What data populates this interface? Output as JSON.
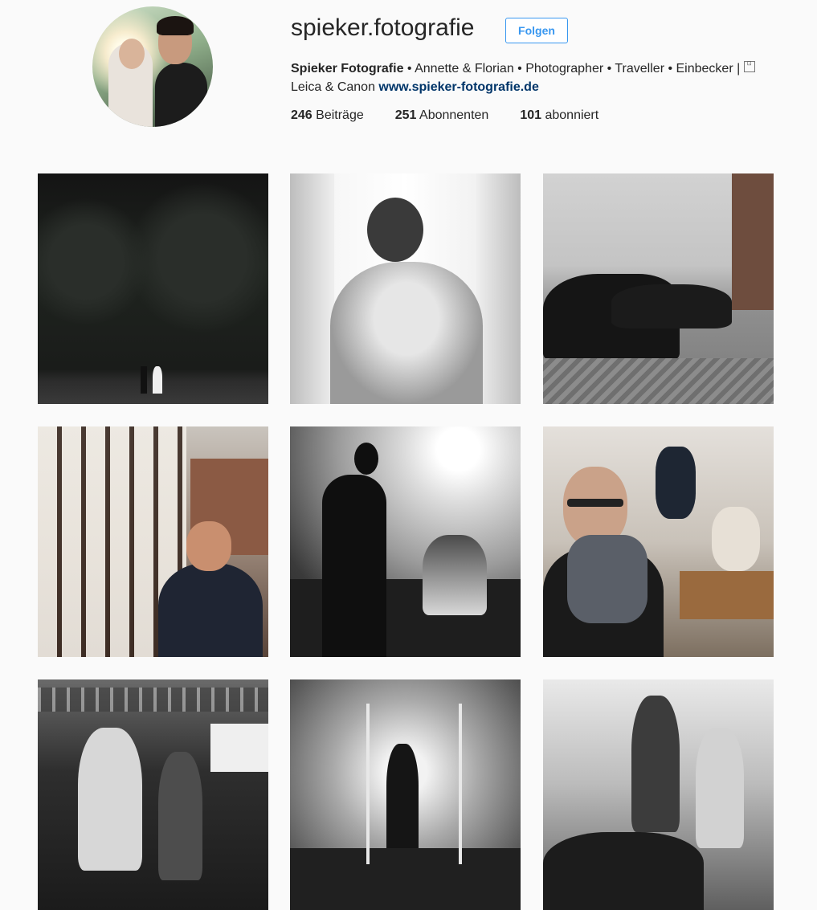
{
  "profile": {
    "username": "spieker.fotografie",
    "follow_label": "Folgen",
    "bio": {
      "name": "Spieker Fotografie",
      "text_line1": " • Annette & Florian • Photographer • Traveller • Einbecker | ",
      "text_line2": "Leica & Canon ",
      "link": "www.spieker-fotografie.de"
    },
    "stats": [
      {
        "count": "246",
        "label": " Beiträge"
      },
      {
        "count": "251",
        "label": " Abonnenten"
      },
      {
        "count": "101",
        "label": " abonniert"
      }
    ],
    "icon": "camera-icon"
  },
  "posts": [
    {
      "label": "post-1"
    },
    {
      "label": "post-2"
    },
    {
      "label": "post-3"
    },
    {
      "label": "post-4"
    },
    {
      "label": "post-5"
    },
    {
      "label": "post-6"
    },
    {
      "label": "post-7"
    },
    {
      "label": "post-8"
    },
    {
      "label": "post-9"
    }
  ]
}
